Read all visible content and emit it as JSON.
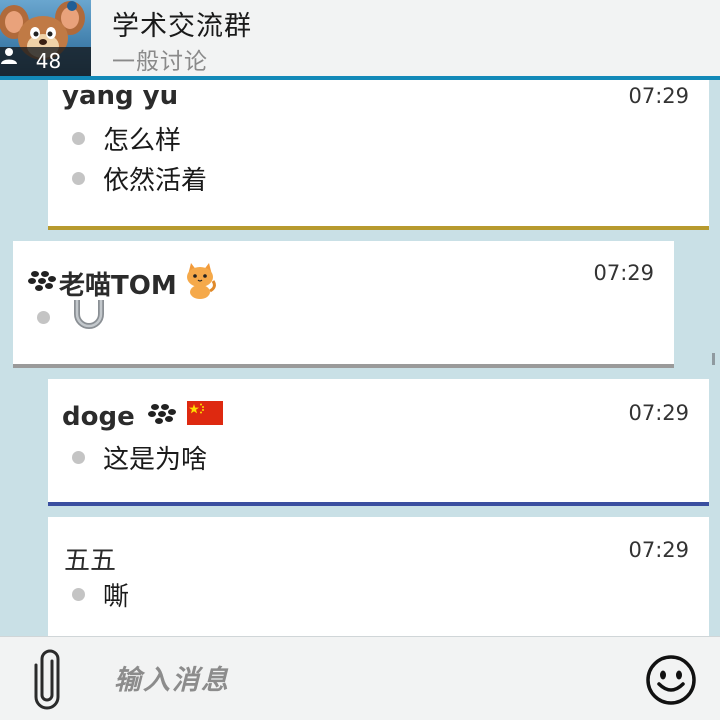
{
  "header": {
    "title": "学术交流群",
    "subtitle": "一般讨论",
    "member_count": "48"
  },
  "messages": [
    {
      "sender": "yang yu",
      "time": "07:29",
      "lines": [
        "怎么样",
        "依然活着"
      ],
      "accent_color": "#b79a2e"
    },
    {
      "sender": "老喵TOM",
      "time": "07:29",
      "lines": [
        ""
      ],
      "accent_color": "#9a9a9a",
      "badges": [
        "blackberry-icon",
        "cat-emoji"
      ]
    },
    {
      "sender": "doge",
      "time": "07:29",
      "lines": [
        "这是为啥"
      ],
      "accent_color": "#3a4fa0",
      "badges": [
        "blackberry-icon",
        "china-flag-emoji"
      ]
    },
    {
      "sender": "五五",
      "time": "07:29",
      "lines": [
        "嘶"
      ],
      "accent_color": "#ffffff"
    }
  ],
  "composer": {
    "placeholder": "输入消息"
  },
  "colors": {
    "header_accent": "#1389b8",
    "background": "#c9e0e6"
  }
}
